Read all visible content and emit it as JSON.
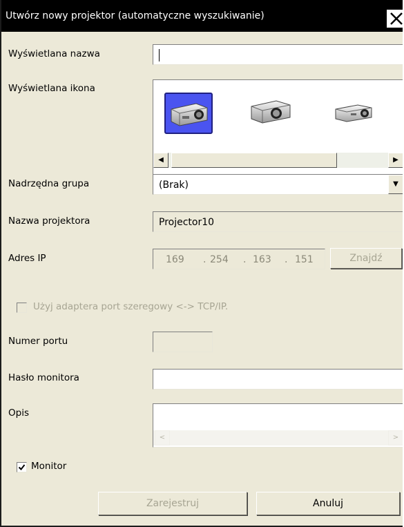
{
  "window": {
    "title": "Utwórz nowy projektor (automatyczne wyszukiwanie)"
  },
  "form": {
    "display_name": {
      "label": "Wyświetlana nazwa",
      "value": ""
    },
    "display_icon": {
      "label": "Wyświetlana ikona",
      "icons": [
        "projector-icon-1",
        "projector-icon-2",
        "projector-icon-3"
      ],
      "selected_index": 0
    },
    "parent_group": {
      "label": "Nadrzędna grupa",
      "value": "(Brak)"
    },
    "projector_name": {
      "label": "Nazwa projektora",
      "value": "Projector10"
    },
    "ip_address": {
      "label": "Adres IP",
      "octets": [
        "169",
        "254",
        "163",
        "151"
      ],
      "find_button": "Znajdź"
    },
    "serial_adapter": {
      "label": "Użyj adaptera port szeregowy <-> TCP/IP.",
      "checked": false,
      "enabled": false
    },
    "port_number": {
      "label": "Numer portu",
      "value": ""
    },
    "monitor_password": {
      "label": "Hasło monitora",
      "value": ""
    },
    "description": {
      "label": "Opis",
      "value": ""
    },
    "monitor": {
      "label": "Monitor",
      "checked": true
    }
  },
  "buttons": {
    "register": "Zarejestruj",
    "cancel": "Anuluj"
  },
  "colors": {
    "dialog_bg": "#ece9d8",
    "titlebar_bg": "#000000",
    "selection": "#4a54f0",
    "disabled_text": "#a7a593"
  }
}
